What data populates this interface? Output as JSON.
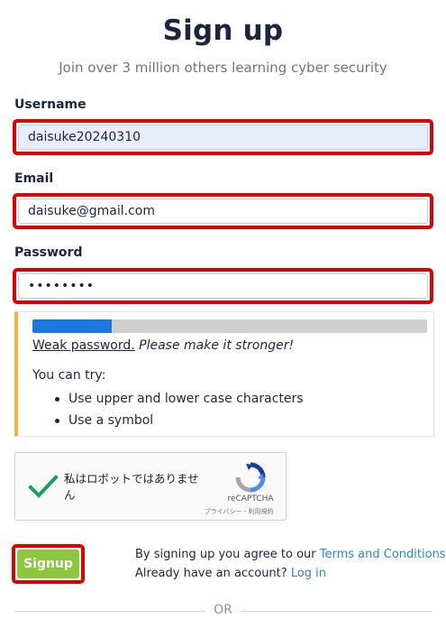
{
  "header": {
    "title": "Sign up",
    "subtitle": "Join over 3 million others learning cyber security"
  },
  "form": {
    "username": {
      "label": "Username",
      "value": "daisuke20240310",
      "placeholder": ""
    },
    "email": {
      "label": "Email",
      "value": "daisuke@gmail.com",
      "placeholder": ""
    },
    "password": {
      "label": "Password",
      "value": "••••••••",
      "placeholder": ""
    }
  },
  "password_strength": {
    "meter_fraction": 0.2,
    "accent_color": "#f2b33a",
    "meter_color": "#1a78e0",
    "weak_label": "Weak password.",
    "hint": "Please make it stronger!",
    "try_label": "You can try:",
    "tips": [
      "Use upper and lower case characters",
      "Use a symbol"
    ]
  },
  "recaptcha": {
    "label": "私はロボットではありません",
    "brand": "reCAPTCHA",
    "links": "プライバシー - 利用規約",
    "checked": true,
    "check_icon": "checkmark-icon",
    "logo_icon": "recaptcha-logo-icon"
  },
  "actions": {
    "signup_label": "Signup",
    "signup_color": "#8dc63f",
    "terms_prefix": "By signing up you agree to our",
    "terms_link": "Terms and Conditions",
    "account_prefix": "Already have an account?",
    "login_link": "Log in",
    "link_color": "#2b86d8"
  },
  "divider": {
    "text": "OR"
  }
}
